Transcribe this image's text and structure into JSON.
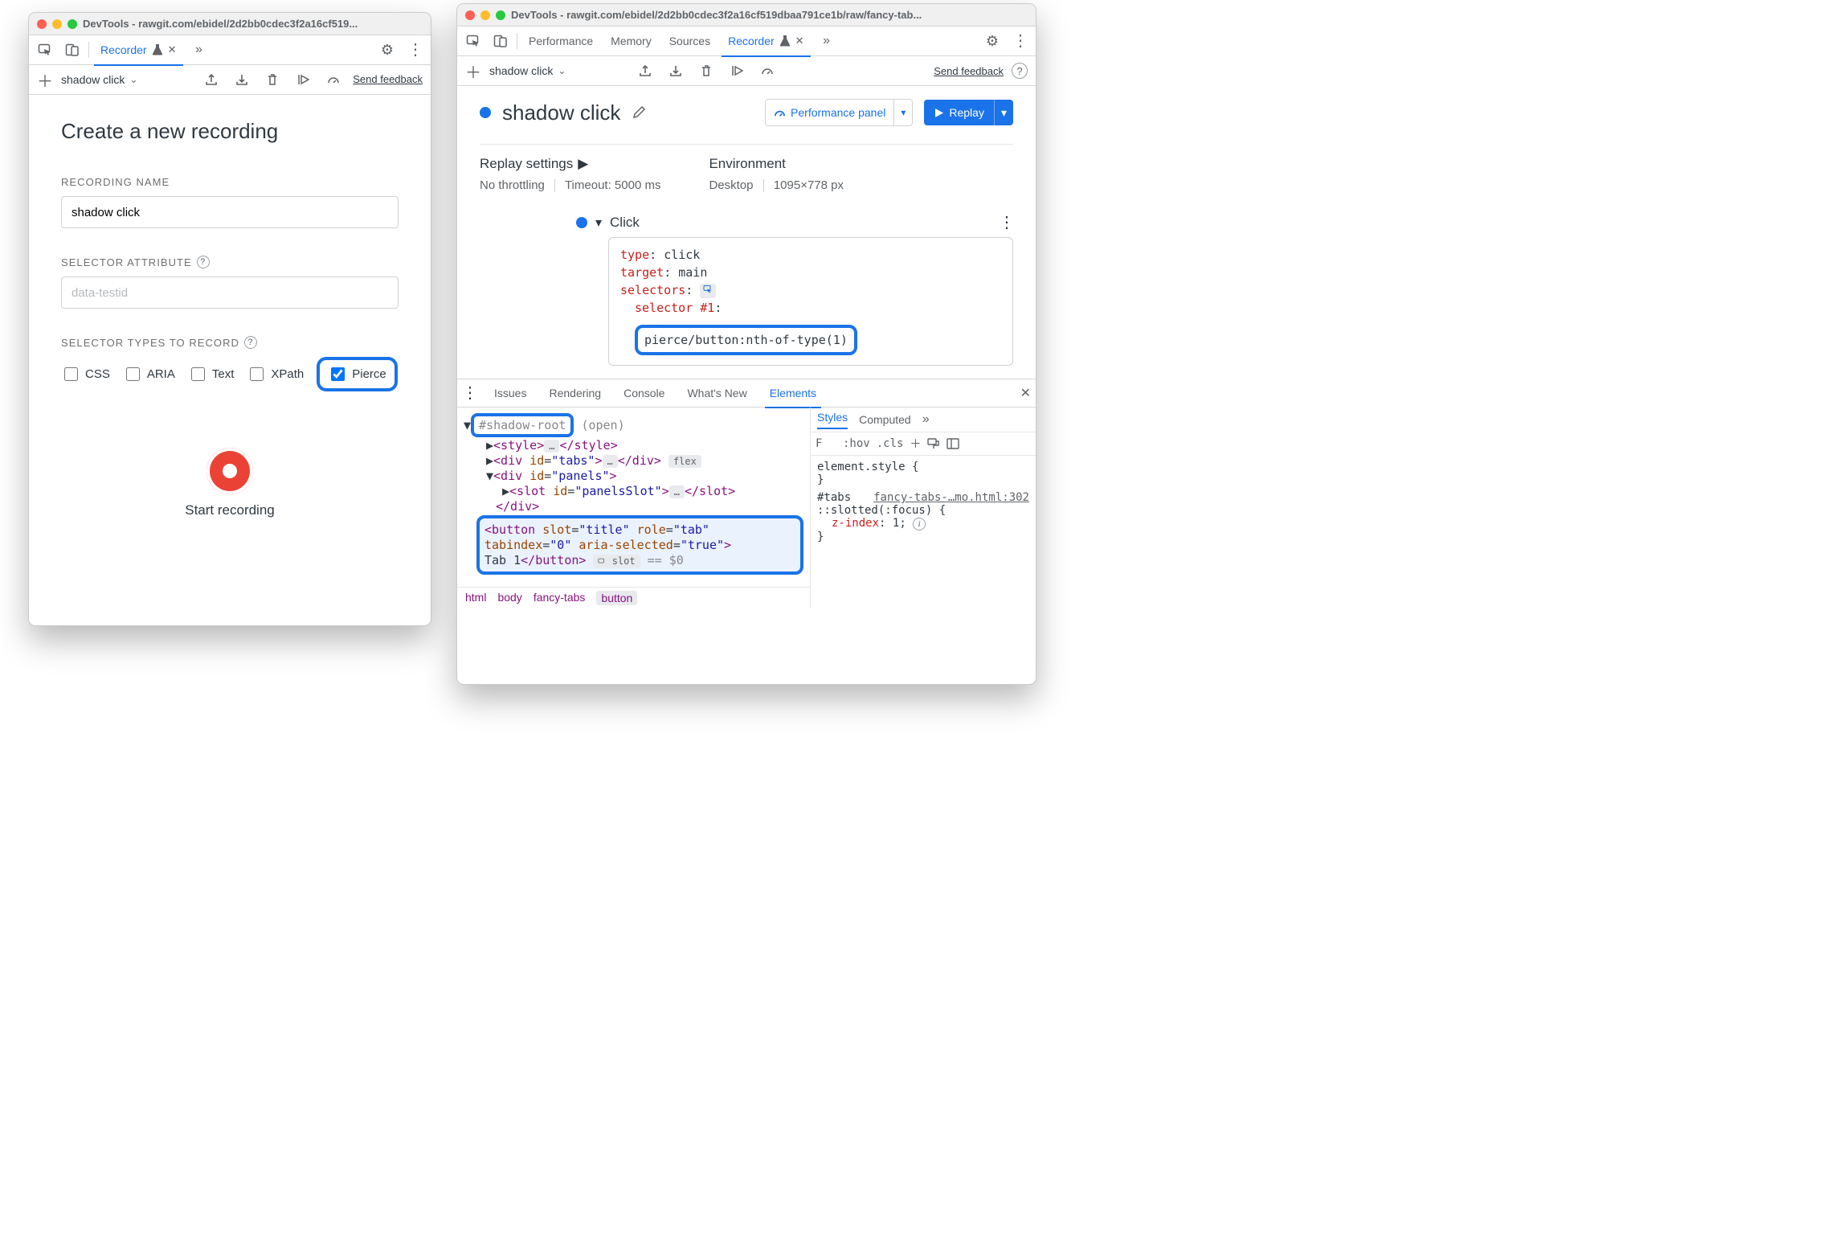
{
  "left": {
    "title": "DevTools - rawgit.com/ebidel/2d2bb0cdec3f2a16cf519...",
    "tabs": {
      "recorder": "Recorder"
    },
    "toolbar": {
      "recording_dropdown": "shadow click",
      "send_feedback": "Send feedback"
    },
    "heading": "Create a new recording",
    "recording_name_label": "RECORDING NAME",
    "recording_name_value": "shadow click",
    "selector_attr_label": "SELECTOR ATTRIBUTE",
    "selector_attr_placeholder": "data-testid",
    "selector_types_label": "SELECTOR TYPES TO RECORD",
    "types": {
      "css": "CSS",
      "aria": "ARIA",
      "text": "Text",
      "xpath": "XPath",
      "pierce": "Pierce"
    },
    "start": "Start recording"
  },
  "right": {
    "title": "DevTools - rawgit.com/ebidel/2d2bb0cdec3f2a16cf519dbaa791ce1b/raw/fancy-tab...",
    "tabs": {
      "performance": "Performance",
      "memory": "Memory",
      "sources": "Sources",
      "recorder": "Recorder"
    },
    "toolbar": {
      "recording_dropdown": "shadow click",
      "send_feedback": "Send feedback"
    },
    "recording_name": "shadow click",
    "perf_panel_btn": "Performance panel",
    "replay_btn": "Replay",
    "replay_settings_h": "Replay settings",
    "throttling": "No throttling",
    "timeout": "Timeout: 5000 ms",
    "env_h": "Environment",
    "env_device": "Desktop",
    "env_size": "1095×778 px",
    "step": {
      "label": "Click",
      "type_k": "type",
      "type_v": "click",
      "target_k": "target",
      "target_v": "main",
      "selectors_k": "selectors",
      "sel1_k": "selector #1",
      "sel1_v": "pierce/button:nth-of-type(1)"
    },
    "drawer_tabs": {
      "issues": "Issues",
      "rendering": "Rendering",
      "console": "Console",
      "whatsnew": "What's New",
      "elements": "Elements"
    },
    "dom": {
      "shadow_root": "#shadow-root",
      "shadow_mode": "(open)",
      "badge_flex": "flex",
      "badge_slot": "slot",
      "btn_text": "Tab 1",
      "eq_dollar": " == $0 "
    },
    "crumbs": {
      "html": "html",
      "body": "body",
      "ft": "fancy-tabs",
      "btn": "button"
    },
    "styles_tabs": {
      "styles": "Styles",
      "computed": "Computed"
    },
    "styles_tool": {
      "filter": "F",
      "hov": ":hov",
      "cls": ".cls"
    },
    "styles_body": {
      "rule1": "element.style {",
      "rule1_close": "}",
      "rule2_sel": "#tabs",
      "rule2_src": "fancy-tabs-…mo.html:302",
      "rule3_sel": "::slotted(:focus) {",
      "rule3_prop": "z-index",
      "rule3_val": "1",
      "rule3_close": "}"
    }
  }
}
